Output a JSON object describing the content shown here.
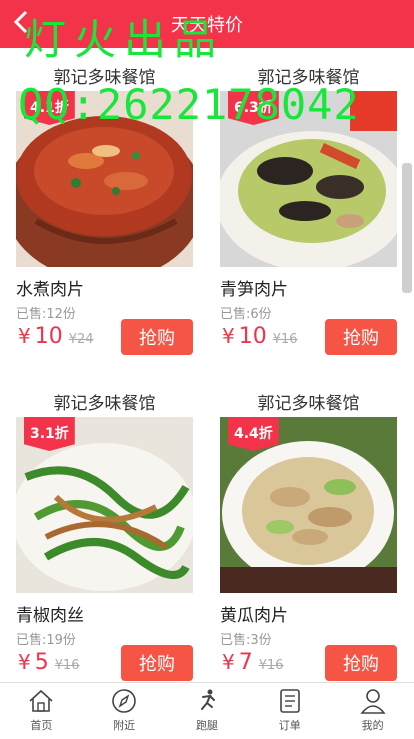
{
  "header": {
    "title": "天天特价"
  },
  "watermark": {
    "line1": "灯火出品",
    "line2": "QQ:2622178042"
  },
  "products": [
    {
      "shop": "郭记多味餐馆",
      "discount": "4.1折",
      "name": "水煮肉片",
      "sold": "已售:12份",
      "currency": "¥",
      "price": "10",
      "original": "¥24",
      "buy": "抢购"
    },
    {
      "shop": "郭记多味餐馆",
      "discount": "6.3折",
      "name": "青笋肉片",
      "sold": "已售:6份",
      "currency": "¥",
      "price": "10",
      "original": "¥16",
      "buy": "抢购"
    },
    {
      "shop": "郭记多味餐馆",
      "discount": "3.1折",
      "name": "青椒肉丝",
      "sold": "已售:19份",
      "currency": "¥",
      "price": "5",
      "original": "¥16",
      "buy": "抢购"
    },
    {
      "shop": "郭记多味餐馆",
      "discount": "4.4折",
      "name": "黄瓜肉片",
      "sold": "已售:3份",
      "currency": "¥",
      "price": "7",
      "original": "¥16",
      "buy": "抢购"
    }
  ],
  "tabs": [
    {
      "label": "首页",
      "icon": "home-icon"
    },
    {
      "label": "附近",
      "icon": "compass-icon"
    },
    {
      "label": "跑腿",
      "icon": "runner-icon"
    },
    {
      "label": "订单",
      "icon": "order-icon"
    },
    {
      "label": "我的",
      "icon": "user-icon"
    }
  ],
  "colors": {
    "accent": "#f2334a",
    "button": "#f65445",
    "watermark": "#18e63a"
  }
}
